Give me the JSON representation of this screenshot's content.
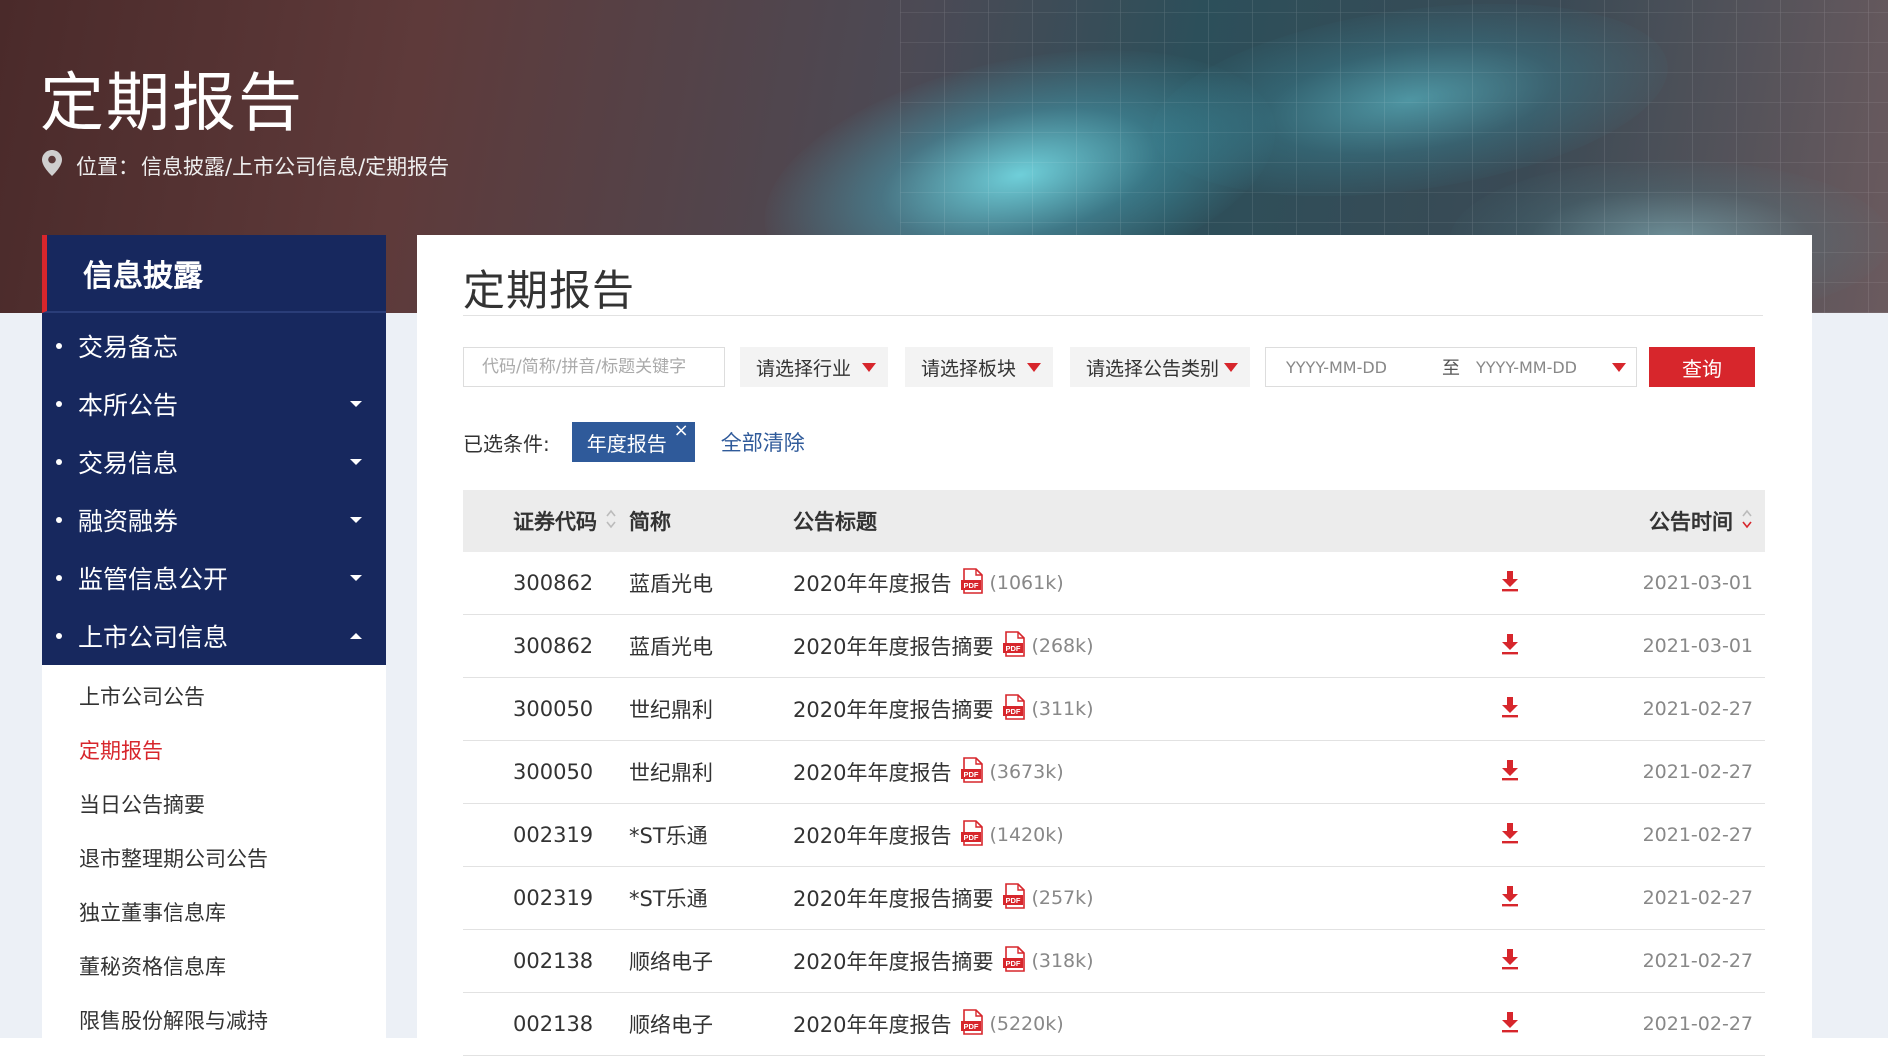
{
  "banner": {
    "title": "定期报告",
    "location_label": "位置：",
    "breadcrumb": "信息披露/上市公司信息/定期报告"
  },
  "sidebar": {
    "header": "信息披露",
    "items": [
      {
        "label": "交易备忘",
        "expandable": false
      },
      {
        "label": "本所公告",
        "expandable": true
      },
      {
        "label": "交易信息",
        "expandable": true
      },
      {
        "label": "融资融券",
        "expandable": true
      },
      {
        "label": "监管信息公开",
        "expandable": true
      },
      {
        "label": "上市公司信息",
        "expandable": true,
        "expanded": true
      }
    ],
    "sub_items": [
      {
        "label": "上市公司公告",
        "active": false
      },
      {
        "label": "定期报告",
        "active": true
      },
      {
        "label": "当日公告摘要",
        "active": false
      },
      {
        "label": "退市整理期公司公告",
        "active": false
      },
      {
        "label": "独立董事信息库",
        "active": false
      },
      {
        "label": "董秘资格信息库",
        "active": false
      },
      {
        "label": "限售股份解限与减持",
        "active": false
      }
    ]
  },
  "main": {
    "title": "定期报告",
    "filters": {
      "keyword_placeholder": "代码/简称/拼音/标题关键字",
      "industry": "请选择行业",
      "board": "请选择板块",
      "category": "请选择公告类别",
      "date_from_placeholder": "YYYY-MM-DD",
      "date_to_label": "至",
      "date_to_placeholder": "YYYY-MM-DD",
      "query_button": "查询"
    },
    "conditions": {
      "label": "已选条件:",
      "tags": [
        "年度报告"
      ],
      "clear_all": "全部清除"
    },
    "table": {
      "headers": {
        "code": "证券代码",
        "name": "简称",
        "title": "公告标题",
        "date": "公告时间"
      },
      "rows": [
        {
          "code": "300862",
          "name": "蓝盾光电",
          "title": "2020年年度报告",
          "size": "(1061k)",
          "date": "2021-03-01"
        },
        {
          "code": "300862",
          "name": "蓝盾光电",
          "title": "2020年年度报告摘要",
          "size": "(268k)",
          "date": "2021-03-01"
        },
        {
          "code": "300050",
          "name": "世纪鼎利",
          "title": "2020年年度报告摘要",
          "size": "(311k)",
          "date": "2021-02-27"
        },
        {
          "code": "300050",
          "name": "世纪鼎利",
          "title": "2020年年度报告",
          "size": "(3673k)",
          "date": "2021-02-27"
        },
        {
          "code": "002319",
          "name": "*ST乐通",
          "title": "2020年年度报告",
          "size": "(1420k)",
          "date": "2021-02-27"
        },
        {
          "code": "002319",
          "name": "*ST乐通",
          "title": "2020年年度报告摘要",
          "size": "(257k)",
          "date": "2021-02-27"
        },
        {
          "code": "002138",
          "name": "顺络电子",
          "title": "2020年年度报告摘要",
          "size": "(318k)",
          "date": "2021-02-27"
        },
        {
          "code": "002138",
          "name": "顺络电子",
          "title": "2020年年度报告",
          "size": "(5220k)",
          "date": "2021-02-27"
        }
      ]
    }
  },
  "colors": {
    "accent_red": "#d7262c",
    "sidebar_navy": "#17285e",
    "tag_blue": "#2f5a9a",
    "page_bg": "#ecf0f6"
  },
  "icons": {
    "location": "map-pin-icon",
    "sort": "sort-updown-icon",
    "pdf": "pdf-file-icon",
    "download": "download-arrow-icon",
    "dropdown": "triangle-down-icon",
    "remove_tag": "close-icon"
  }
}
